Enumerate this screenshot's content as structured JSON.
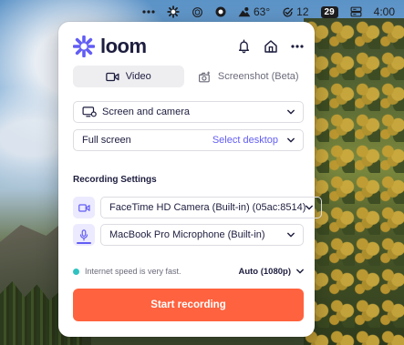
{
  "menubar": {
    "weather_temp": "63°",
    "tasks_count": "12",
    "calendar_day": "29",
    "clock": "4:00"
  },
  "loom": {
    "brand": "loom",
    "brand_color": "#625df5",
    "tabs": [
      {
        "label": "Video",
        "icon": "video-camera-icon",
        "active": true
      },
      {
        "label": "Screenshot (Beta)",
        "icon": "screenshot-camera-icon",
        "active": false
      }
    ],
    "capture_mode": {
      "value": "Screen and camera",
      "icon": "screen-camera-icon"
    },
    "screen_option": {
      "value": "Full screen",
      "action": "Select desktop"
    },
    "recording_settings_title": "Recording Settings",
    "camera": {
      "value": "FaceTime HD Camera (Built-in) (05ac:8514)",
      "icon": "camera-icon"
    },
    "microphone": {
      "value": "MacBook Pro Microphone (Built-in)",
      "icon": "microphone-icon"
    },
    "status": {
      "text": "Internet speed is very fast.",
      "dot_color": "#2fc2c0"
    },
    "quality": "Auto (1080p)",
    "start_button": "Start recording",
    "start_button_color": "#ff623e"
  }
}
